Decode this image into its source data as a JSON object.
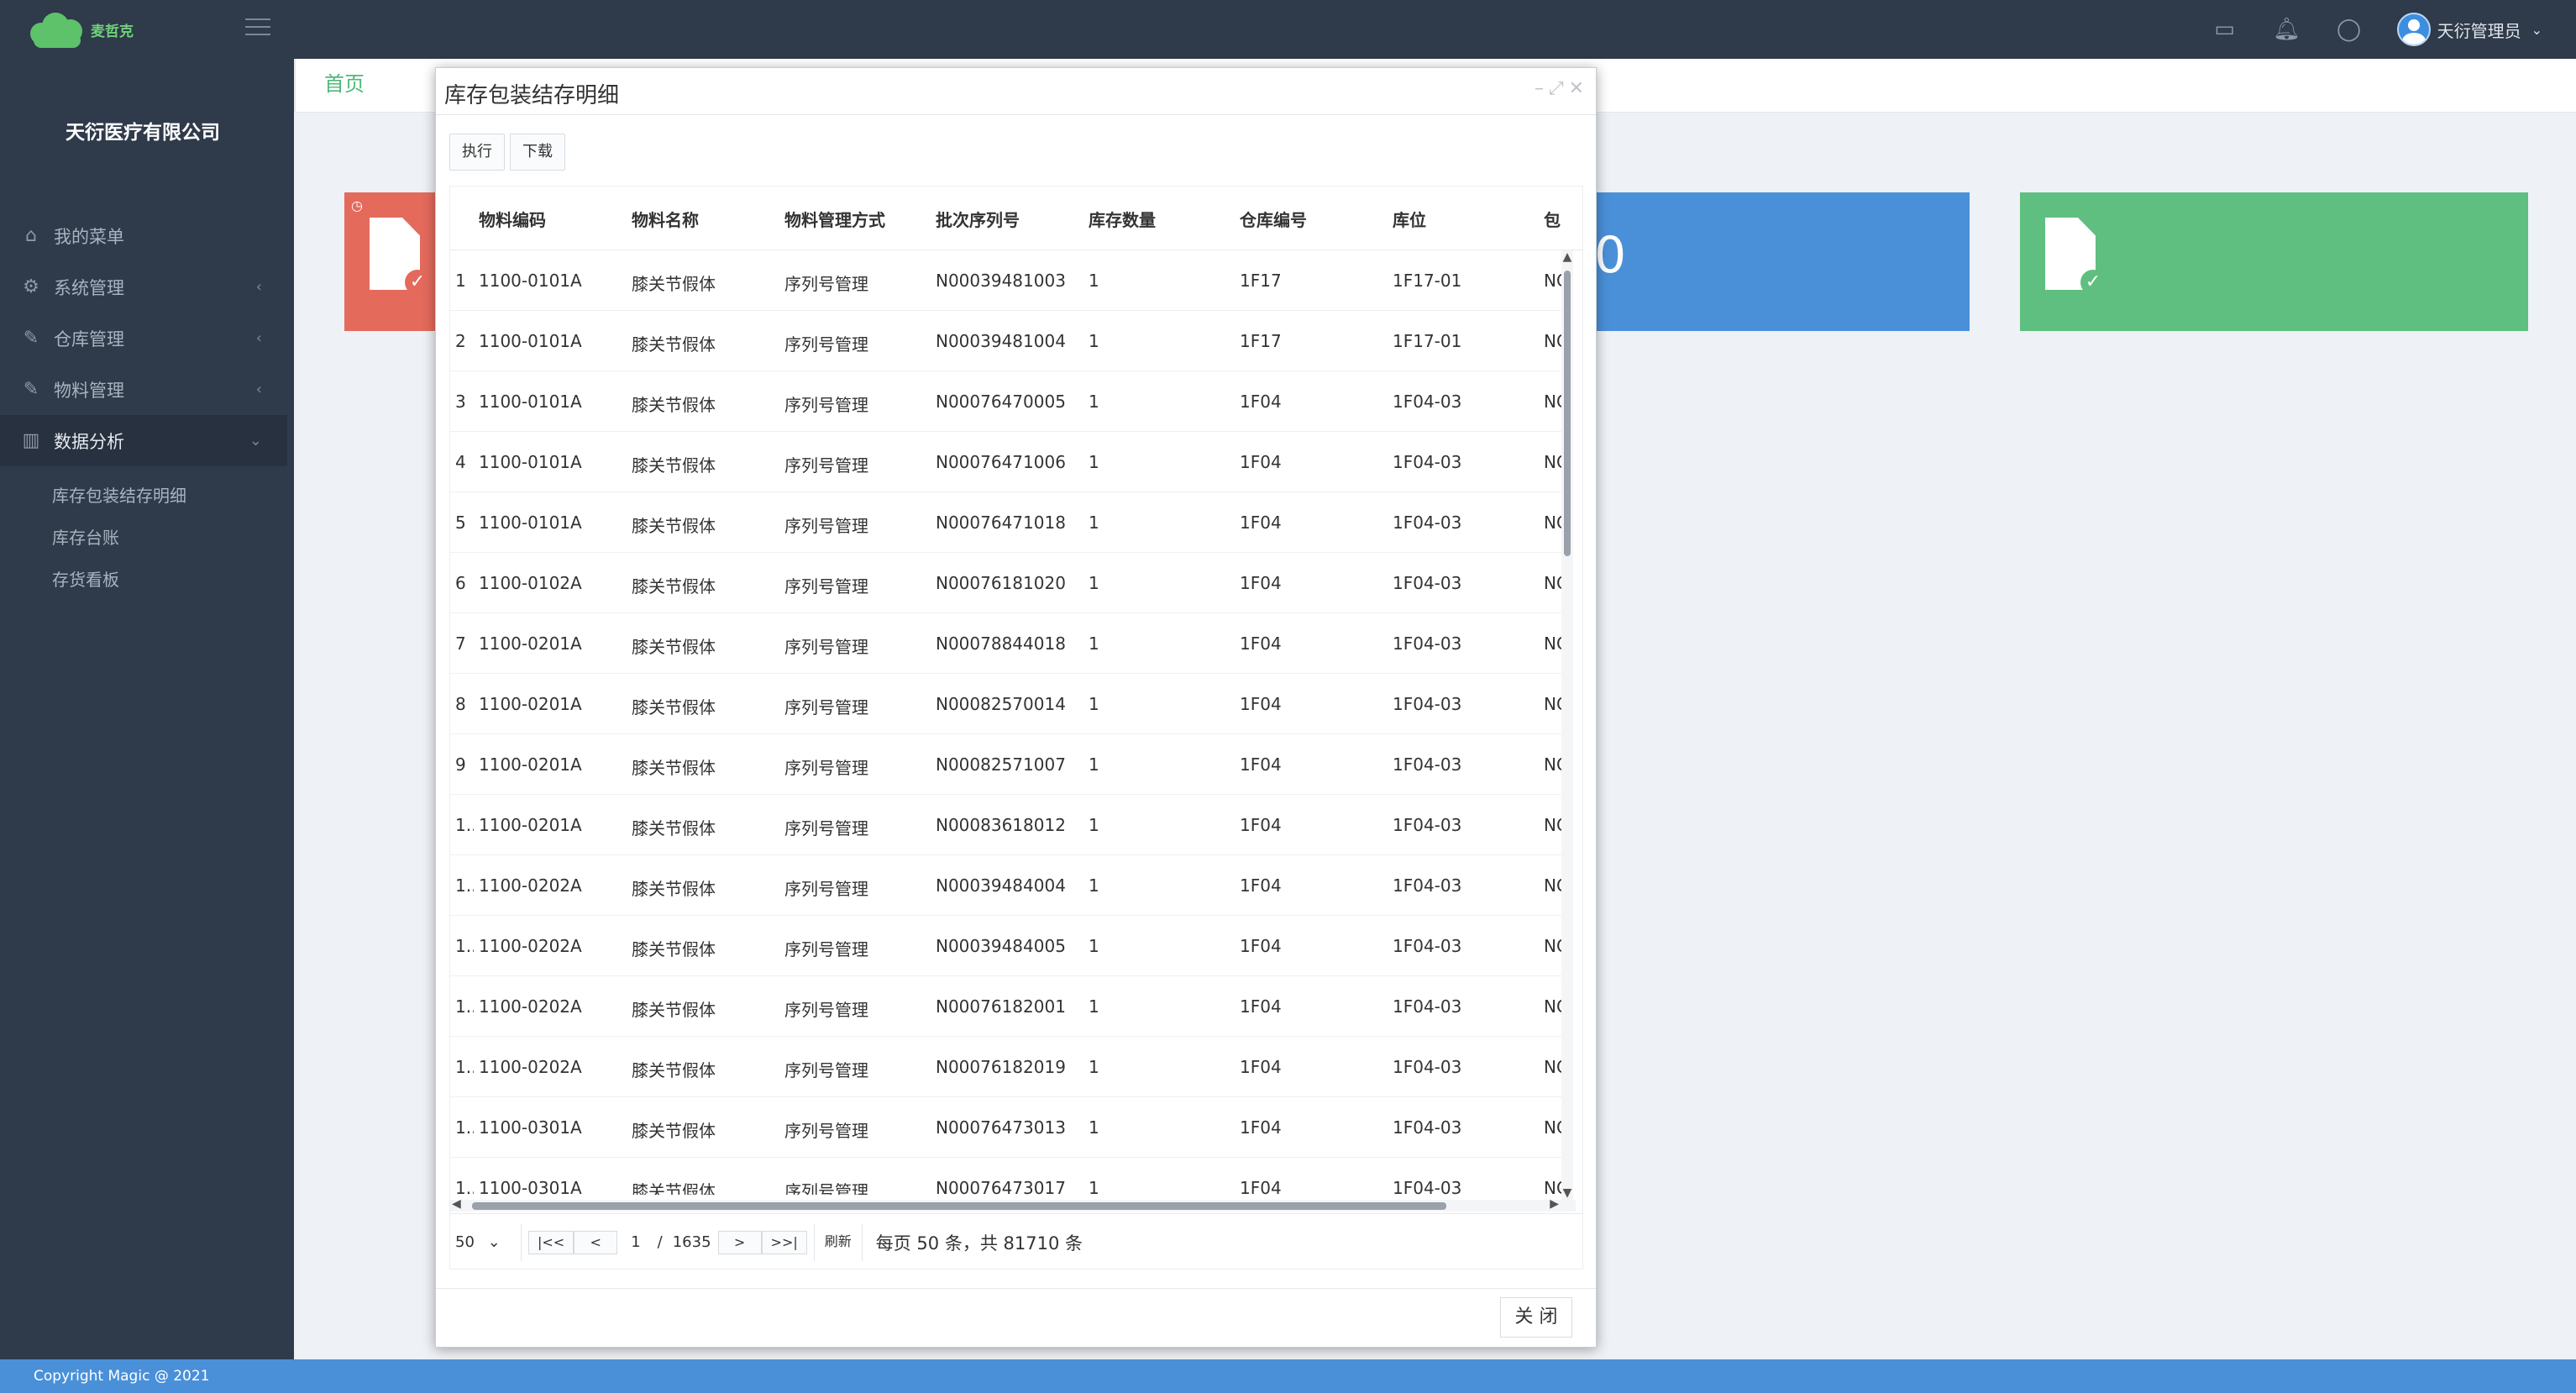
{
  "app": {
    "logo_text": "麦哲克",
    "company": "天衍医疗有限公司",
    "user_name": "天衍管理员",
    "footer": "Copyright Magic @ 2021"
  },
  "sidebar": {
    "items": [
      {
        "label": "我的菜单",
        "icon": "home-icon"
      },
      {
        "label": "系统管理",
        "icon": "gear-icon"
      },
      {
        "label": "仓库管理",
        "icon": "edit-icon"
      },
      {
        "label": "物料管理",
        "icon": "edit-icon"
      },
      {
        "label": "数据分析",
        "icon": "bar-chart-icon"
      }
    ],
    "subitems": [
      "库存包装结存明细",
      "库存台账",
      "存货看板"
    ]
  },
  "tabs": {
    "home": "首页"
  },
  "cards": {
    "blue_value": "0"
  },
  "modal": {
    "title": "库存包装结存明细",
    "execute_label": "执行",
    "download_label": "下载",
    "columns": [
      "物料编码",
      "物料名称",
      "物料管理方式",
      "批次序列号",
      "库存数量",
      "仓库编号",
      "库位",
      "包装"
    ],
    "rows": [
      {
        "n": "1",
        "code": "1100-0101A",
        "name": "膝关节假体",
        "mode": "序列号管理",
        "serial": "N00039481003",
        "qty": "1",
        "wh": "1F17",
        "loc": "1F17-01",
        "pkg": "NC"
      },
      {
        "n": "2",
        "code": "1100-0101A",
        "name": "膝关节假体",
        "mode": "序列号管理",
        "serial": "N00039481004",
        "qty": "1",
        "wh": "1F17",
        "loc": "1F17-01",
        "pkg": "NC"
      },
      {
        "n": "3",
        "code": "1100-0101A",
        "name": "膝关节假体",
        "mode": "序列号管理",
        "serial": "N00076470005",
        "qty": "1",
        "wh": "1F04",
        "loc": "1F04-03",
        "pkg": "NC"
      },
      {
        "n": "4",
        "code": "1100-0101A",
        "name": "膝关节假体",
        "mode": "序列号管理",
        "serial": "N00076471006",
        "qty": "1",
        "wh": "1F04",
        "loc": "1F04-03",
        "pkg": "NC"
      },
      {
        "n": "5",
        "code": "1100-0101A",
        "name": "膝关节假体",
        "mode": "序列号管理",
        "serial": "N00076471018",
        "qty": "1",
        "wh": "1F04",
        "loc": "1F04-03",
        "pkg": "NC"
      },
      {
        "n": "6",
        "code": "1100-0102A",
        "name": "膝关节假体",
        "mode": "序列号管理",
        "serial": "N00076181020",
        "qty": "1",
        "wh": "1F04",
        "loc": "1F04-03",
        "pkg": "NC"
      },
      {
        "n": "7",
        "code": "1100-0201A",
        "name": "膝关节假体",
        "mode": "序列号管理",
        "serial": "N00078844018",
        "qty": "1",
        "wh": "1F04",
        "loc": "1F04-03",
        "pkg": "NC"
      },
      {
        "n": "8",
        "code": "1100-0201A",
        "name": "膝关节假体",
        "mode": "序列号管理",
        "serial": "N00082570014",
        "qty": "1",
        "wh": "1F04",
        "loc": "1F04-03",
        "pkg": "NC"
      },
      {
        "n": "9",
        "code": "1100-0201A",
        "name": "膝关节假体",
        "mode": "序列号管理",
        "serial": "N00082571007",
        "qty": "1",
        "wh": "1F04",
        "loc": "1F04-03",
        "pkg": "NC"
      },
      {
        "n": "1..",
        "code": "1100-0201A",
        "name": "膝关节假体",
        "mode": "序列号管理",
        "serial": "N00083618012",
        "qty": "1",
        "wh": "1F04",
        "loc": "1F04-03",
        "pkg": "NC"
      },
      {
        "n": "1..",
        "code": "1100-0202A",
        "name": "膝关节假体",
        "mode": "序列号管理",
        "serial": "N00039484004",
        "qty": "1",
        "wh": "1F04",
        "loc": "1F04-03",
        "pkg": "NC"
      },
      {
        "n": "1..",
        "code": "1100-0202A",
        "name": "膝关节假体",
        "mode": "序列号管理",
        "serial": "N00039484005",
        "qty": "1",
        "wh": "1F04",
        "loc": "1F04-03",
        "pkg": "NC"
      },
      {
        "n": "1..",
        "code": "1100-0202A",
        "name": "膝关节假体",
        "mode": "序列号管理",
        "serial": "N00076182001",
        "qty": "1",
        "wh": "1F04",
        "loc": "1F04-03",
        "pkg": "NC"
      },
      {
        "n": "1..",
        "code": "1100-0202A",
        "name": "膝关节假体",
        "mode": "序列号管理",
        "serial": "N00076182019",
        "qty": "1",
        "wh": "1F04",
        "loc": "1F04-03",
        "pkg": "NC"
      },
      {
        "n": "1..",
        "code": "1100-0301A",
        "name": "膝关节假体",
        "mode": "序列号管理",
        "serial": "N00076473013",
        "qty": "1",
        "wh": "1F04",
        "loc": "1F04-03",
        "pkg": "NC"
      },
      {
        "n": "1..",
        "code": "1100-0301A",
        "name": "膝关节假体",
        "mode": "序列号管理",
        "serial": "N00076473017",
        "qty": "1",
        "wh": "1F04",
        "loc": "1F04-03",
        "pkg": "NC"
      }
    ],
    "pager": {
      "page_size": "50",
      "first": "|<<",
      "prev": "<",
      "page": "1",
      "slash": "/",
      "total_pages": "1635",
      "next": ">",
      "last": ">>|",
      "refresh": "刷新",
      "info": "每页 50 条，共 81710 条"
    },
    "close_label": "关 闭"
  },
  "colors": {
    "header_bg": "#2f3a4a",
    "accent_green": "#4fb97a",
    "card_red": "#e46a5c",
    "card_blue": "#4a90d9",
    "card_green": "#5fbf80"
  }
}
